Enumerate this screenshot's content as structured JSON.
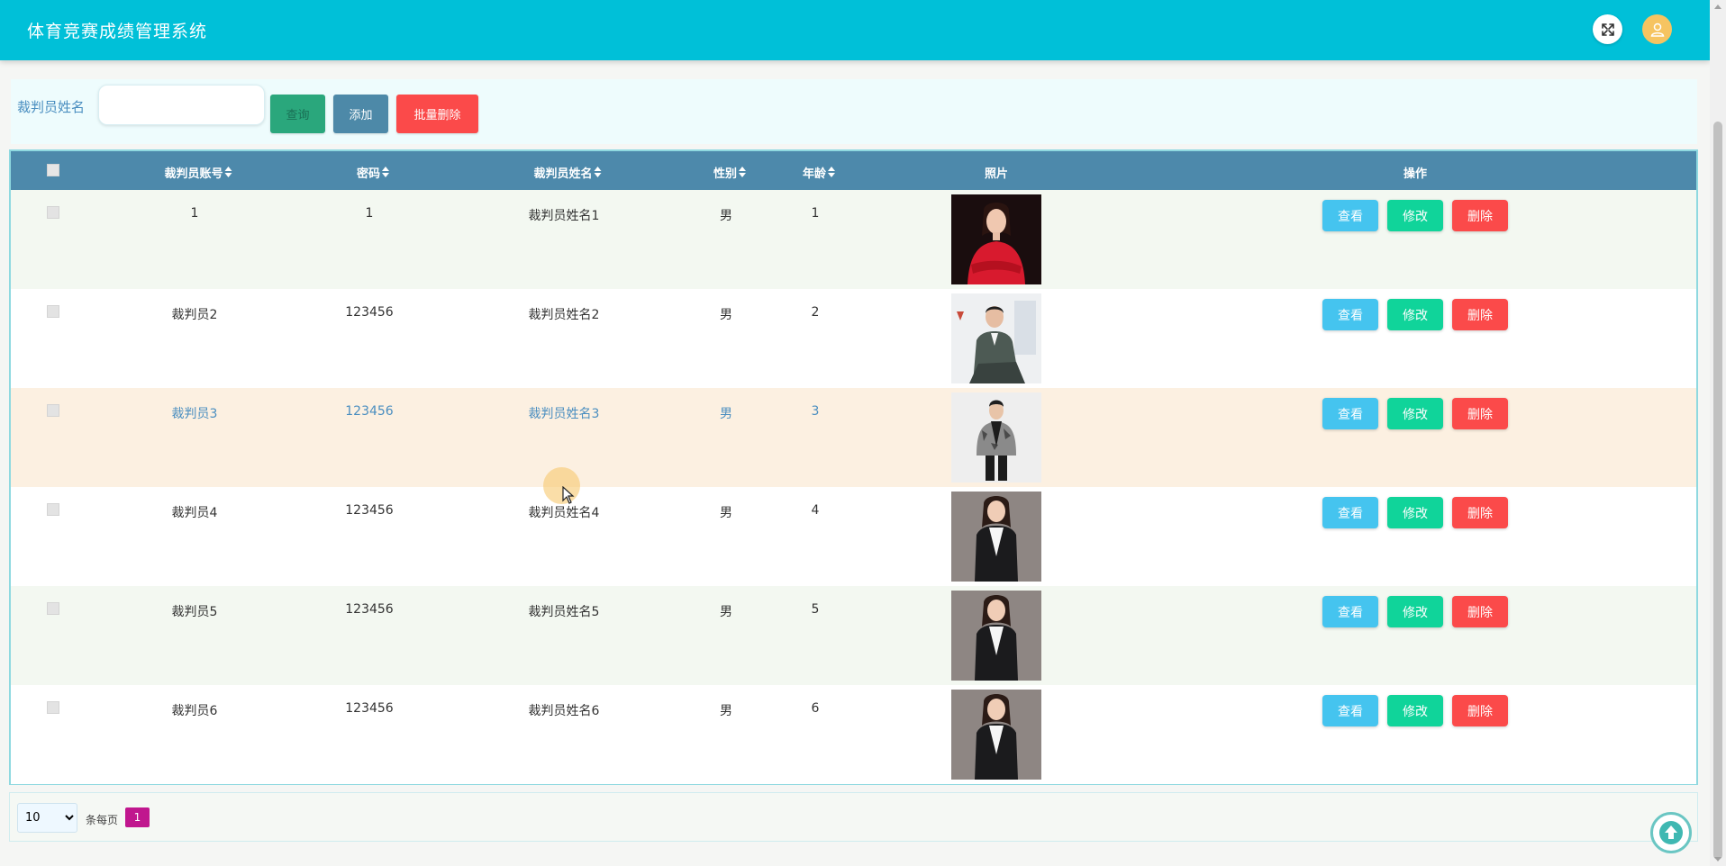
{
  "app": {
    "title": "体育竞赛成绩管理系统"
  },
  "icons": {
    "expand": "expand-icon",
    "user": "user-icon",
    "back_to_top": "arrow-up-circle-icon",
    "sort": "sort-icon"
  },
  "colors": {
    "topbar": "#00c0d8",
    "table_header": "#4d89ab",
    "view": "#45c4ef",
    "edit": "#10d49a",
    "delete": "#fb4a4a",
    "page_active": "#c0178e"
  },
  "search": {
    "label": "裁判员姓名",
    "value": "",
    "placeholder": "",
    "query_label": "查询",
    "add_label": "添加",
    "batch_delete_label": "批量删除"
  },
  "table": {
    "columns": [
      "裁判员账号",
      "密码",
      "裁判员姓名",
      "性别",
      "年龄",
      "照片",
      "操作"
    ],
    "actions": {
      "view": "查看",
      "edit": "修改",
      "delete": "删除"
    },
    "rows": [
      {
        "account": "1",
        "password": "1",
        "name": "裁判员姓名1",
        "gender": "男",
        "age": "1",
        "photo": "red-dress-woman"
      },
      {
        "account": "裁判员2",
        "password": "123456",
        "name": "裁判员姓名2",
        "gender": "男",
        "age": "2",
        "photo": "seated-man-suit"
      },
      {
        "account": "裁判员3",
        "password": "123456",
        "name": "裁判员姓名3",
        "gender": "男",
        "age": "3",
        "photo": "man-camo-jacket"
      },
      {
        "account": "裁判员4",
        "password": "123456",
        "name": "裁判员姓名4",
        "gender": "男",
        "age": "4",
        "photo": "woman-black-blazer"
      },
      {
        "account": "裁判员5",
        "password": "123456",
        "name": "裁判员姓名5",
        "gender": "男",
        "age": "5",
        "photo": "woman-black-blazer"
      },
      {
        "account": "裁判员6",
        "password": "123456",
        "name": "裁判员姓名6",
        "gender": "男",
        "age": "6",
        "photo": "woman-black-blazer"
      }
    ]
  },
  "pagination": {
    "page_size": "10",
    "per_page_label": "条每页",
    "current_page": "1"
  }
}
